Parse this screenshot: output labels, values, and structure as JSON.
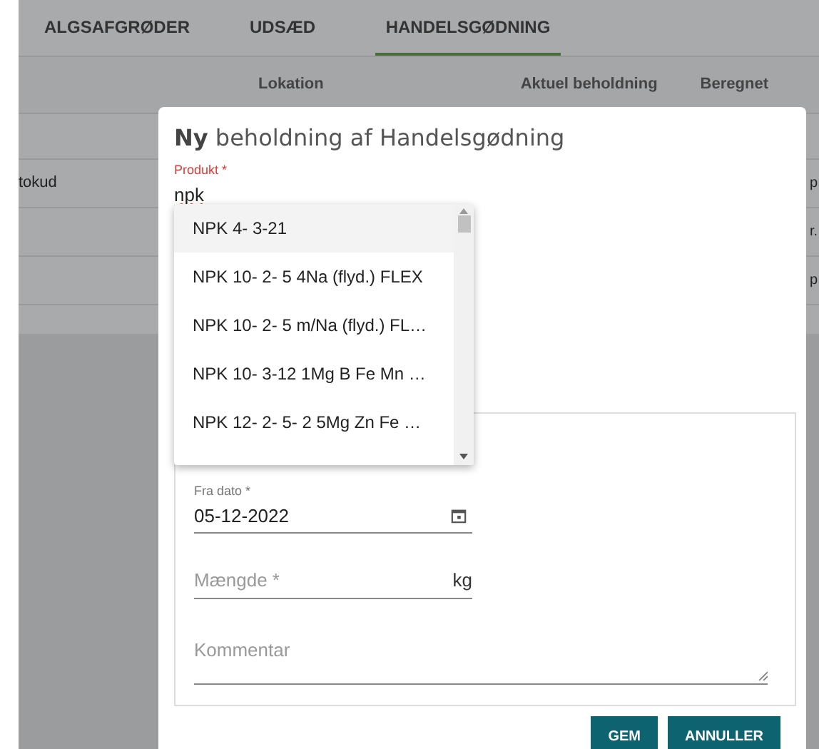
{
  "tabs": [
    {
      "label": "ALGSAFGRØDER",
      "selected": false
    },
    {
      "label": "UDSÆD",
      "selected": false
    },
    {
      "label": "HANDELSGØDNING",
      "selected": true
    }
  ],
  "table": {
    "columns": [
      "Lokation",
      "Aktuel beholdning",
      "Beregnet"
    ],
    "rows": [
      {
        "column_1": "",
        "column_4": ""
      },
      {
        "column_1": "tokud",
        "column_4": "p"
      },
      {
        "column_1": "",
        "column_4": "r."
      },
      {
        "column_1": "",
        "column_4": "p"
      }
    ]
  },
  "dialog": {
    "title_bold": "Ny",
    "title_rest": "beholdning af Handelsgødning",
    "product": {
      "label": "Produkt *",
      "value": "npk"
    },
    "options": [
      {
        "label": "NPK 4- 3-21",
        "selected": true
      },
      {
        "label": "NPK 10- 2- 5 4Na (flyd.) FLEX",
        "selected": false
      },
      {
        "label": "NPK 10- 2- 5 m/Na (flyd.) FL…",
        "selected": false
      },
      {
        "label": "NPK 10- 3-12 1Mg B Fe Mn …",
        "selected": false
      },
      {
        "label": "NPK 12- 2- 5- 2 5Mg Zn Fe …",
        "selected": false
      }
    ],
    "date": {
      "label": "Fra dato *",
      "value": "05-12-2022"
    },
    "amount": {
      "placeholder": "Mængde *",
      "unit": "kg"
    },
    "comment": {
      "placeholder": "Kommentar"
    },
    "buttons": [
      "GEM",
      "ANNULLER"
    ]
  }
}
